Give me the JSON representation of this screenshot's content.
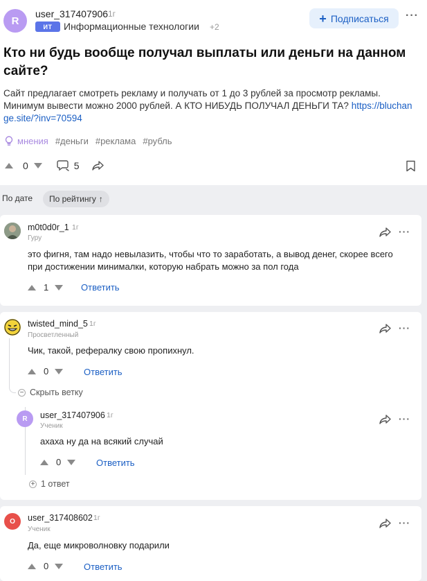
{
  "post": {
    "author": "user_317407906",
    "author_initial": "R",
    "age": "1г",
    "category_icon": "ИТ",
    "category": "Информационные технологии",
    "category_more": "+2",
    "subscribe_label": "Подписаться",
    "title": "Кто ни будь вообще получал выплаты или деньги на данном сайте?",
    "body_line1": "Сайт предлагает смотреть рекламу и получать от 1 до 3 рублей за просмотр рекламы.",
    "body_line2": "Минимум вывести можно 2000 рублей. А КТО НИБУДЬ ПОЛУЧАЛ ДЕНЬГИ ТА?",
    "body_link_part1": "https://bluchan",
    "body_link_part2": "ge.site/?inv=70594",
    "tag_opinion": "мнения",
    "tags": [
      "#деньги",
      "#реклама",
      "#рубль"
    ],
    "votes": "0",
    "comments": "5"
  },
  "sort": {
    "by_date": "По дате",
    "by_rating": "По рейтингу"
  },
  "comments": [
    {
      "author": "m0t0d0r_1",
      "age": "1г",
      "rank": "Гуру",
      "text_line1": "это фигня, там надо невылазить, чтобы что то заработать, а вывод денег, скорее всего",
      "text_line2": "при достижении минималки, которую набрать можно за пол года",
      "votes": "1",
      "reply": "Ответить"
    },
    {
      "author": "twisted_mind_5",
      "age": "1г",
      "rank": "Просветленный",
      "text": "Чик, такой, рефералку свою пропихнул.",
      "votes": "0",
      "reply": "Ответить",
      "hide_branch": "Скрыть ветку",
      "child": {
        "author": "user_317407906",
        "initial": "R",
        "age": "1г",
        "rank": "Ученик",
        "text": "ахаха ну да на всякий случай",
        "votes": "0",
        "reply": "Ответить",
        "replies": "1 ответ"
      }
    },
    {
      "author": "user_317408602",
      "initial": "O",
      "age": "1г",
      "rank": "Ученик",
      "text": "Да, еще микроволновку подарили",
      "votes": "0",
      "reply": "Ответить"
    }
  ],
  "colors": {
    "accent": "#1b5fc4",
    "avatar_purple": "#b99bf2",
    "avatar_red": "#e8504a",
    "background": "#eeeff2"
  }
}
